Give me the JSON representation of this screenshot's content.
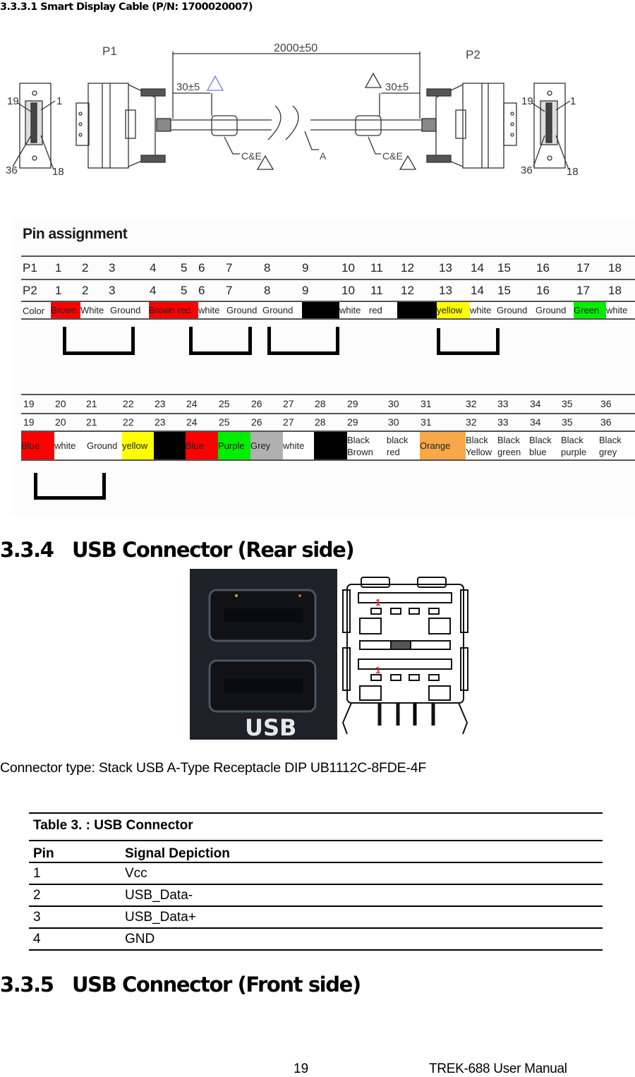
{
  "page": {
    "subheading": "3.3.3.1 Smart Display Cable (P/N: 1700020007)",
    "page_number": "19",
    "manual_title": "TREK-688 User Manual"
  },
  "cable_drawing": {
    "p1_label": "P1",
    "p2_label": "P2",
    "overall_length": "2000±50",
    "left_offset": "30±5",
    "right_offset": "30±5",
    "core_label_left": "C&E",
    "core_label_right": "C&E",
    "cable_label": "A",
    "pin_labels": {
      "top_left": "19",
      "top_right": "1",
      "bottom_left": "36",
      "bottom_right": "18"
    }
  },
  "pin_assignment": {
    "title": "Pin assignment",
    "top": {
      "p1_label": "P1",
      "p2_label": "P2",
      "color_label": "Color",
      "pins": [
        "1",
        "2",
        "3",
        "4",
        "5",
        "6",
        "7",
        "8",
        "9",
        "10",
        "11",
        "12",
        "13",
        "14",
        "15",
        "16",
        "17",
        "18"
      ],
      "colors": [
        {
          "text": "Brown",
          "bg": "#ff0000"
        },
        {
          "text": "White",
          "bg": "#ffffff"
        },
        {
          "text": "Ground",
          "bg": "#ffffff"
        },
        {
          "text": "Brown red",
          "bg": "#ff0000"
        },
        {
          "text": "white",
          "bg": "#ffffff"
        },
        {
          "text": "Ground",
          "bg": "#ffffff"
        },
        {
          "text": "Ground",
          "bg": "#ffffff"
        },
        {
          "text": "",
          "bg": "#000000"
        },
        {
          "text": "white",
          "bg": "#ffffff"
        },
        {
          "text": "red",
          "bg": "#ffffff"
        },
        {
          "text": "",
          "bg": "#000000"
        },
        {
          "text": "yellow",
          "bg": "#ffff00"
        },
        {
          "text": "white",
          "bg": "#ffffff"
        },
        {
          "text": "Ground",
          "bg": "#ffffff"
        },
        {
          "text": "Ground",
          "bg": "#ffffff"
        },
        {
          "text": "Green",
          "bg": "#00ee00"
        },
        {
          "text": "white",
          "bg": "#ffffff"
        }
      ]
    },
    "bottom": {
      "pins": [
        "19",
        "20",
        "21",
        "22",
        "23",
        "24",
        "25",
        "26",
        "27",
        "28",
        "29",
        "30",
        "31",
        "32",
        "33",
        "34",
        "35",
        "36"
      ],
      "colors": [
        {
          "text": "Blue",
          "bg": "#ff0000"
        },
        {
          "text": "white",
          "bg": "#ffffff"
        },
        {
          "text": "Ground",
          "bg": "#ffffff"
        },
        {
          "text": "yellow",
          "bg": "#ffff00"
        },
        {
          "text": "",
          "bg": "#000000"
        },
        {
          "text": "Blue",
          "bg": "#ff0000"
        },
        {
          "text": "Purple",
          "bg": "#00ee00"
        },
        {
          "text": "Grey",
          "bg": "#b0b0b0"
        },
        {
          "text": "white",
          "bg": "#ffffff"
        },
        {
          "text": "",
          "bg": "#000000"
        },
        {
          "text": "Black\nBrown",
          "bg": "#ffffff"
        },
        {
          "text": "black\nred",
          "bg": "#ffffff"
        },
        {
          "text": "Orange",
          "bg": "#f8a848"
        },
        {
          "text": "Black\nYellow",
          "bg": "#ffffff"
        },
        {
          "text": "Black\ngreen",
          "bg": "#ffffff"
        },
        {
          "text": "Black\nblue",
          "bg": "#ffffff"
        },
        {
          "text": "Black\npurple",
          "bg": "#ffffff"
        },
        {
          "text": "Black\ngrey",
          "bg": "#ffffff"
        }
      ]
    }
  },
  "usb_rear": {
    "heading_number": "3.3.4",
    "heading_text": "USB Connector (Rear side)",
    "photo_label": "USB",
    "pin1_marker": "1",
    "connector_type": "Connector type: Stack USB A-Type Receptacle DIP UB1112C-8FDE-4F",
    "table": {
      "caption": "Table 3.  : USB Connector",
      "headers": [
        "Pin",
        "Signal Depiction"
      ],
      "rows": [
        [
          "1",
          "Vcc"
        ],
        [
          "2",
          "USB_Data-"
        ],
        [
          "3",
          "USB_Data+"
        ],
        [
          "4",
          "GND"
        ]
      ]
    }
  },
  "usb_front": {
    "heading_number": "3.3.5",
    "heading_text": "USB Connector (Front side)"
  }
}
